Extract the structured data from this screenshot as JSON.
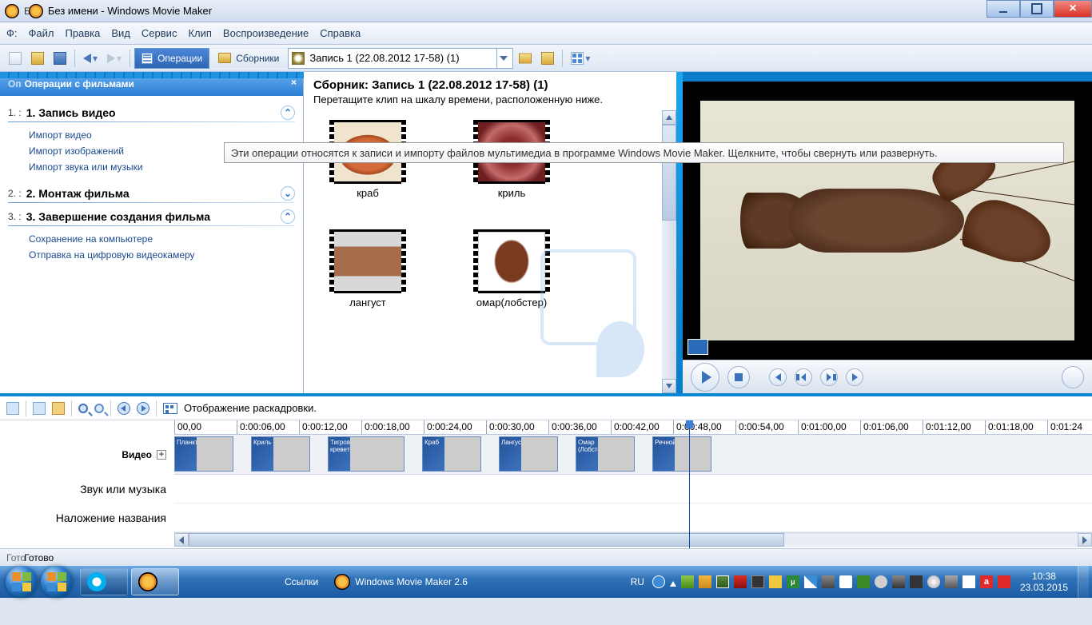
{
  "window": {
    "title": "Без имени - Windows Movie Maker",
    "title_prefix": "Б"
  },
  "menu": {
    "file": "Файл",
    "edit": "Правка",
    "view": "Вид",
    "service": "Сервис",
    "clip": "Клип",
    "playback": "Воспроизведение",
    "help": "Справка",
    "q": "Ф:"
  },
  "toolbar": {
    "ops": "Операции",
    "sbor": "Сборники",
    "combo": "Запись 1 (22.08.2012 17-58) (1)"
  },
  "taskpane": {
    "heading_prefix": "Оп",
    "heading": "Операции с фильмами",
    "s1_num": "1. :",
    "s1": "1. Запись видео",
    "s1_links": [
      "Импорт видео",
      "Импорт изображений",
      "Импорт звука или музыки"
    ],
    "s2_num": "2. :",
    "s2": "2. Монтаж фильма",
    "s3_num": "3. :",
    "s3": "3. Завершение создания фильма",
    "s3_links": [
      "Сохранение на компьютере",
      "Отправка на цифровую видеокамеру"
    ]
  },
  "tooltip": "Эти операции относятся к записи и импорту файлов мультимедиа в программе Windows Movie Maker. Щелкните, чтобы свернуть или развернуть.",
  "collection": {
    "title": "Сборник: Запись 1 (22.08.2012 17-58) (1)",
    "subtitle": "Перетащите клип на шкалу времени, расположенную ниже.",
    "clips": [
      "краб",
      "криль",
      "лангуст",
      "омар(лобстер)"
    ]
  },
  "timeline": {
    "storyboard": "Отображение раскадровки.",
    "ticks": [
      "00,00",
      "0:00:06,00",
      "0:00:12,00",
      "0:00:18,00",
      "0:00:24,00",
      "0:00:30,00",
      "0:00:36,00",
      "0:00:42,00",
      "0:00:48,00",
      "0:00:54,00",
      "0:01:00,00",
      "0:01:06,00",
      "0:01:12,00",
      "0:01:18,00",
      "0:01:24"
    ],
    "tracks": {
      "video": "Видео",
      "audio": "Звук или музыка",
      "title": "Наложение названия"
    },
    "clips": [
      {
        "title": "Планкт",
        "style": "s-plankton"
      },
      {
        "title": "Криль",
        "style": "s-krill"
      },
      {
        "title": "Тигров креветка",
        "style": "s-tiger"
      },
      {
        "title": "Краб",
        "style": "s-crab"
      },
      {
        "title": "Лангуст",
        "style": "s-spiny"
      },
      {
        "title": "Омар (Лобстер)",
        "style": "s-lobster"
      },
      {
        "title": "Речной",
        "style": "s-cray"
      }
    ],
    "playhead_tick": 8
  },
  "status": {
    "prefix": "Гото",
    "text": "Готово"
  },
  "taskbar": {
    "links": "Ссылки",
    "app": "Windows Movie Maker 2.6",
    "lang": "RU",
    "time": "10:38",
    "date": "23.03.2015"
  }
}
